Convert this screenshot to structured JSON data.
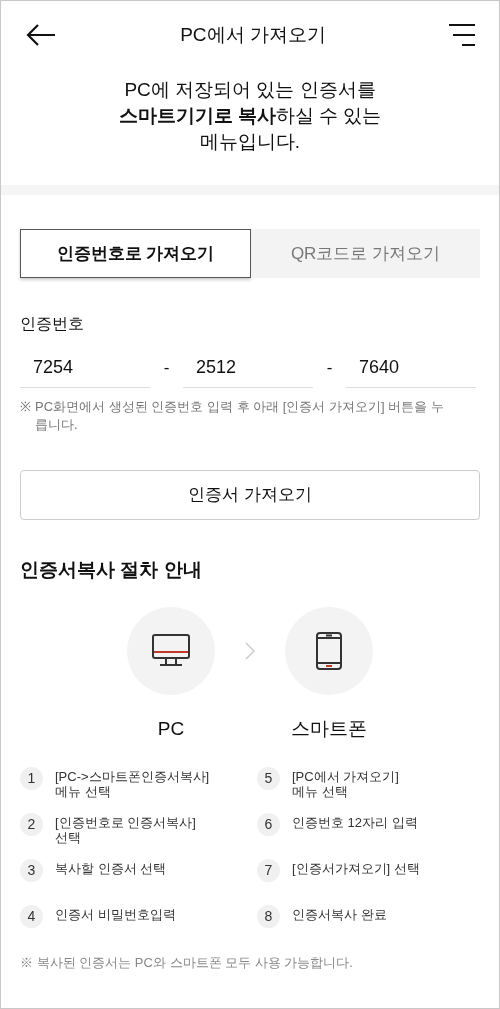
{
  "header": {
    "title": "PC에서 가져오기"
  },
  "intro": {
    "lines": [
      "PC에 저장되어 있는 인증서를",
      "**스마트기기로 복사**하실 수 있는",
      "메뉴입니다."
    ]
  },
  "tabs": [
    {
      "label": "인증번호로 가져오기",
      "selected": true
    },
    {
      "label": "QR코드로 가져오기",
      "selected": false
    }
  ],
  "code": {
    "label": "인증번호",
    "fields": [
      "7254",
      "2512",
      "7640"
    ],
    "separator": "-",
    "note_mark": "※",
    "note": "PC화면에서 생성된 인증번호 입력 후 아래 [인증서 가져오기] 버튼을 누릅니다."
  },
  "import_button": "인증서 가져오기",
  "guide": {
    "title": "인증서복사 절차 안내",
    "devices": [
      {
        "kind": "pc",
        "label": "PC"
      },
      {
        "kind": "phone",
        "label": "스마트폰"
      }
    ],
    "steps": [
      {
        "number": "1",
        "text": "[PC->스마트폰인증서복사]\n메뉴 선택"
      },
      {
        "number": "2",
        "text": "[인증번호로 인증서복사]\n선택"
      },
      {
        "number": "3",
        "text": "복사할 인증서 선택"
      },
      {
        "number": "4",
        "text": "인증서 비밀번호입력"
      },
      {
        "number": "5",
        "text": "[PC에서 가져오기]\n메뉴 선택"
      },
      {
        "number": "6",
        "text": "인증번호 12자리 입력"
      },
      {
        "number": "7",
        "text": "[인증서가져오기] 선택"
      },
      {
        "number": "8",
        "text": "인증서복사 완료"
      }
    ],
    "footnote": "※ 복사된 인증서는 PC와 스마트폰 모두 사용 가능합니다."
  }
}
